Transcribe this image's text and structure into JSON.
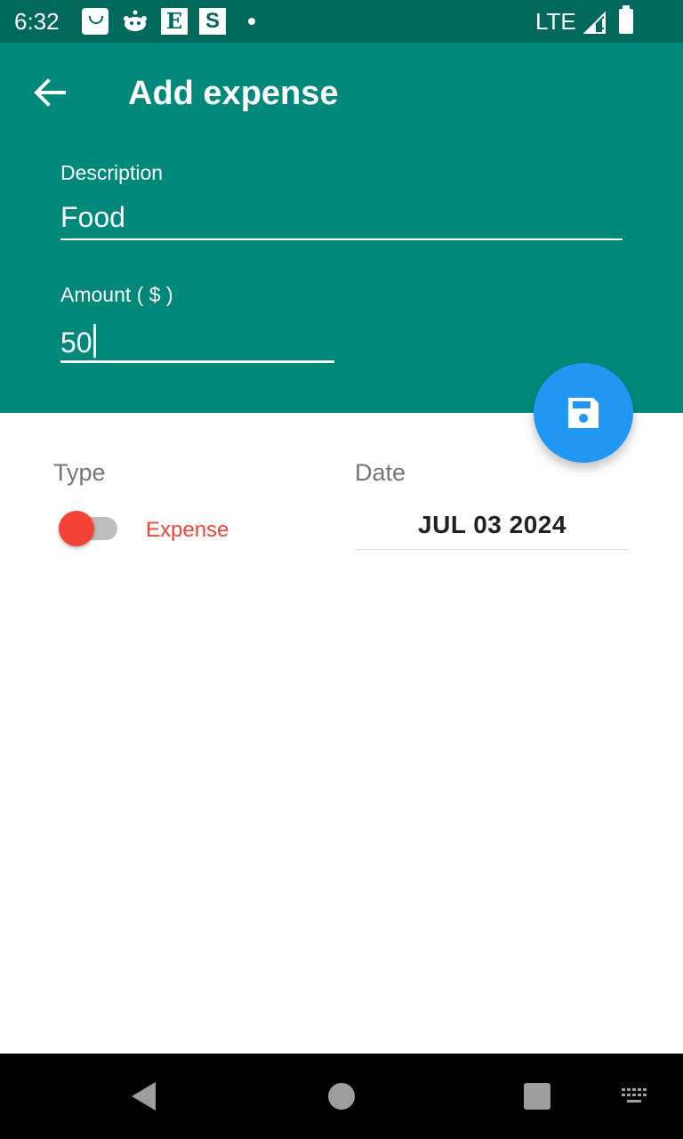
{
  "status_bar": {
    "time": "6:32",
    "network": "LTE",
    "notification_icons": [
      "shopping-bag-icon",
      "reddit-icon",
      "etsy-icon",
      "s-app-icon",
      "more-dot-icon"
    ],
    "e_letter": "E",
    "s_letter": "S"
  },
  "app_bar": {
    "title": "Add expense",
    "back_icon": "arrow-back-icon",
    "color": "#00897b"
  },
  "form": {
    "description_label": "Description",
    "description_value": "Food",
    "amount_label": "Amount ( $ )",
    "amount_value": "50"
  },
  "fab": {
    "icon": "save-icon",
    "color": "#2196f3"
  },
  "details": {
    "type_label": "Type",
    "type_value": "Expense",
    "type_color": "#f44336",
    "date_label": "Date",
    "date_value": "JUL 03 2024"
  },
  "nav_bar": {
    "icons": [
      "nav-back-icon",
      "nav-home-icon",
      "nav-recents-icon",
      "keyboard-icon"
    ]
  }
}
